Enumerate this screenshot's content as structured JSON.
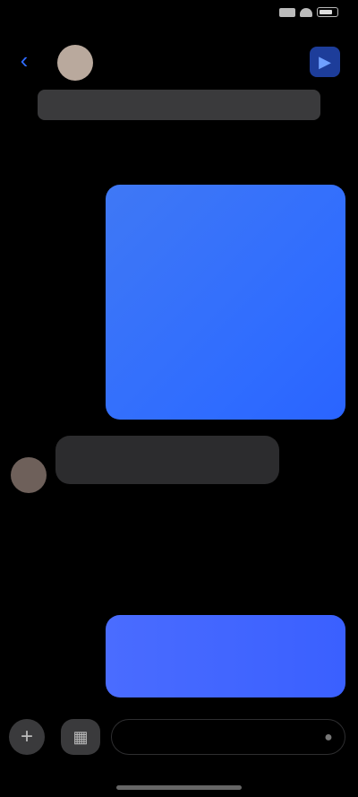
{
  "status_bar": {
    "time": "",
    "icons": [
      "signal-icon",
      "wifi-icon",
      "battery-icon"
    ]
  },
  "header": {
    "contact_name": "",
    "back_icon": "chevron-left-icon",
    "call_icon": "video-call-icon"
  },
  "banner": {
    "text": ""
  },
  "timestamp": "",
  "messages": [
    {
      "direction": "outgoing",
      "text": ""
    },
    {
      "direction": "incoming",
      "text": ""
    },
    {
      "direction": "incoming",
      "text": ""
    },
    {
      "direction": "outgoing",
      "text": ""
    }
  ],
  "delivered_label": "",
  "composer": {
    "placeholder": "",
    "plus_icon": "plus-icon",
    "apps_icon": "apps-icon",
    "mic_icon": "mic-icon"
  },
  "colors": {
    "accent": "#2f6cff",
    "background": "#000000",
    "incoming_bubble": "#2c2c2e"
  }
}
